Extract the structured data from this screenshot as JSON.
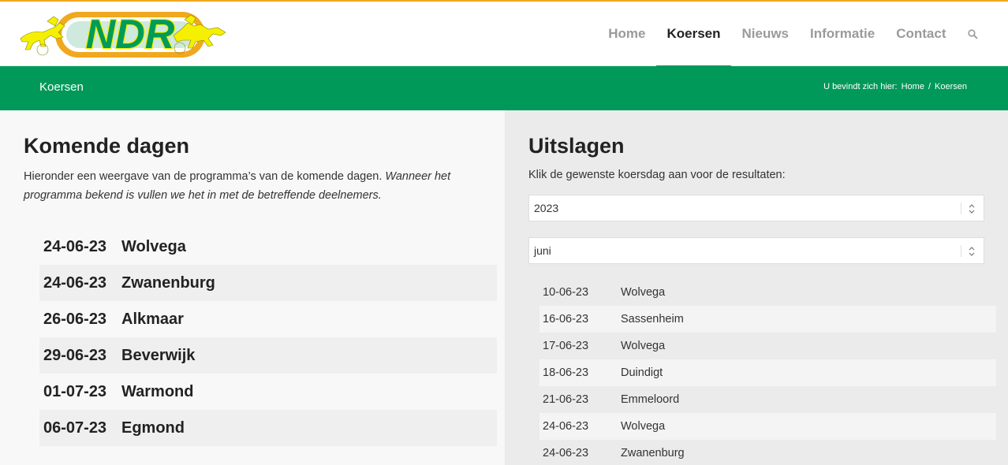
{
  "colors": {
    "accent_green": "#00995a",
    "top_bar": "#f0a81f",
    "logo_yellow": "#f5f000",
    "logo_orange": "#f0a81f",
    "logo_green": "#009b5a"
  },
  "logo": {
    "text": "NDR"
  },
  "nav": {
    "items": [
      {
        "label": "Home",
        "active": false
      },
      {
        "label": "Koersen",
        "active": true
      },
      {
        "label": "Nieuws",
        "active": false
      },
      {
        "label": "Informatie",
        "active": false
      },
      {
        "label": "Contact",
        "active": false
      }
    ],
    "search_icon": "search-icon"
  },
  "banner": {
    "title": "Koersen",
    "breadcrumb": {
      "prefix": "U bevindt zich hier:",
      "home": "Home",
      "separator": "/",
      "current": "Koersen"
    }
  },
  "left": {
    "heading": "Komende dagen",
    "intro_plain": "Hieronder een weergave van de programma’s van de komende dagen. ",
    "intro_italic": "Wanneer het programma bekend is vullen we het in met de betreffende deelnemers.",
    "upcoming": [
      {
        "date": "24-06-23",
        "place": "Wolvega"
      },
      {
        "date": "24-06-23",
        "place": "Zwanenburg"
      },
      {
        "date": "26-06-23",
        "place": "Alkmaar"
      },
      {
        "date": "29-06-23",
        "place": "Beverwijk"
      },
      {
        "date": "01-07-23",
        "place": "Warmond"
      },
      {
        "date": "06-07-23",
        "place": "Egmond"
      }
    ]
  },
  "right": {
    "heading": "Uitslagen",
    "intro": "Klik de gewenste koersdag aan voor de resultaten:",
    "year_select": {
      "value": "2023"
    },
    "month_select": {
      "value": "juni"
    },
    "results": [
      {
        "date": "10-06-23",
        "place": "Wolvega"
      },
      {
        "date": "16-06-23",
        "place": "Sassenheim"
      },
      {
        "date": "17-06-23",
        "place": "Wolvega"
      },
      {
        "date": "18-06-23",
        "place": "Duindigt"
      },
      {
        "date": "21-06-23",
        "place": "Emmeloord"
      },
      {
        "date": "24-06-23",
        "place": "Wolvega"
      },
      {
        "date": "24-06-23",
        "place": "Zwanenburg"
      }
    ]
  }
}
